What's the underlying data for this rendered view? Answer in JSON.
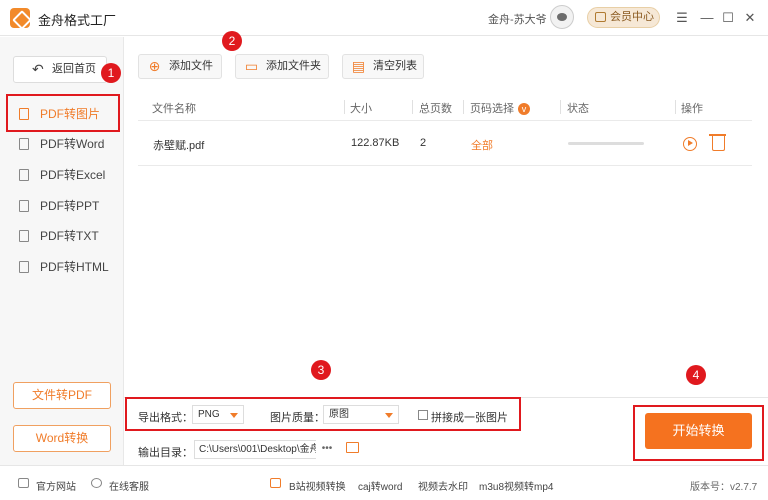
{
  "app": {
    "title": "金舟格式工厂",
    "user": "金舟-苏大爷",
    "vip": "会员中心",
    "win": {
      "menu": "☰",
      "min": "—",
      "max": "☐",
      "close": "✕"
    }
  },
  "sidebar": {
    "home": "返回首页",
    "items": [
      "PDF转图片",
      "PDF转Word",
      "PDF转Excel",
      "PDF转PPT",
      "PDF转TXT",
      "PDF转HTML"
    ],
    "active_index": 0,
    "btn1": "文件转PDF",
    "btn2": "Word转换"
  },
  "toolbar": {
    "add_file": "添加文件",
    "add_folder": "添加文件夹",
    "clear": "清空列表"
  },
  "table": {
    "headers": {
      "name": "文件名称",
      "size": "大小",
      "pages": "总页数",
      "range": "页码选择",
      "status": "状态",
      "action": "操作"
    },
    "range_badge": "v",
    "rows": [
      {
        "name": "赤壁赋.pdf",
        "size": "122.87KB",
        "pages": "2",
        "range": "全部",
        "progress": 0.0
      }
    ]
  },
  "bottom": {
    "fmt_label": "导出格式：",
    "fmt_value": "PNG",
    "quality_label": "图片质量：",
    "quality_value": "原图",
    "merge_label": "拼接成一张图片",
    "out_label": "输出目录：",
    "out_path": "C:\\Users\\001\\Desktop\\金舟",
    "dots": "•••",
    "start": "开始转换"
  },
  "footer": {
    "site": "官方网站",
    "service": "在线客服",
    "links": [
      "B站视频转换",
      "caj转word",
      "视频去水印",
      "m3u8视频转mp4"
    ],
    "version": "版本号：v2.7.7"
  },
  "markers": [
    "1",
    "2",
    "3",
    "4"
  ],
  "colors": {
    "accent": "#f07c2a",
    "highlight": "#e0191e"
  }
}
